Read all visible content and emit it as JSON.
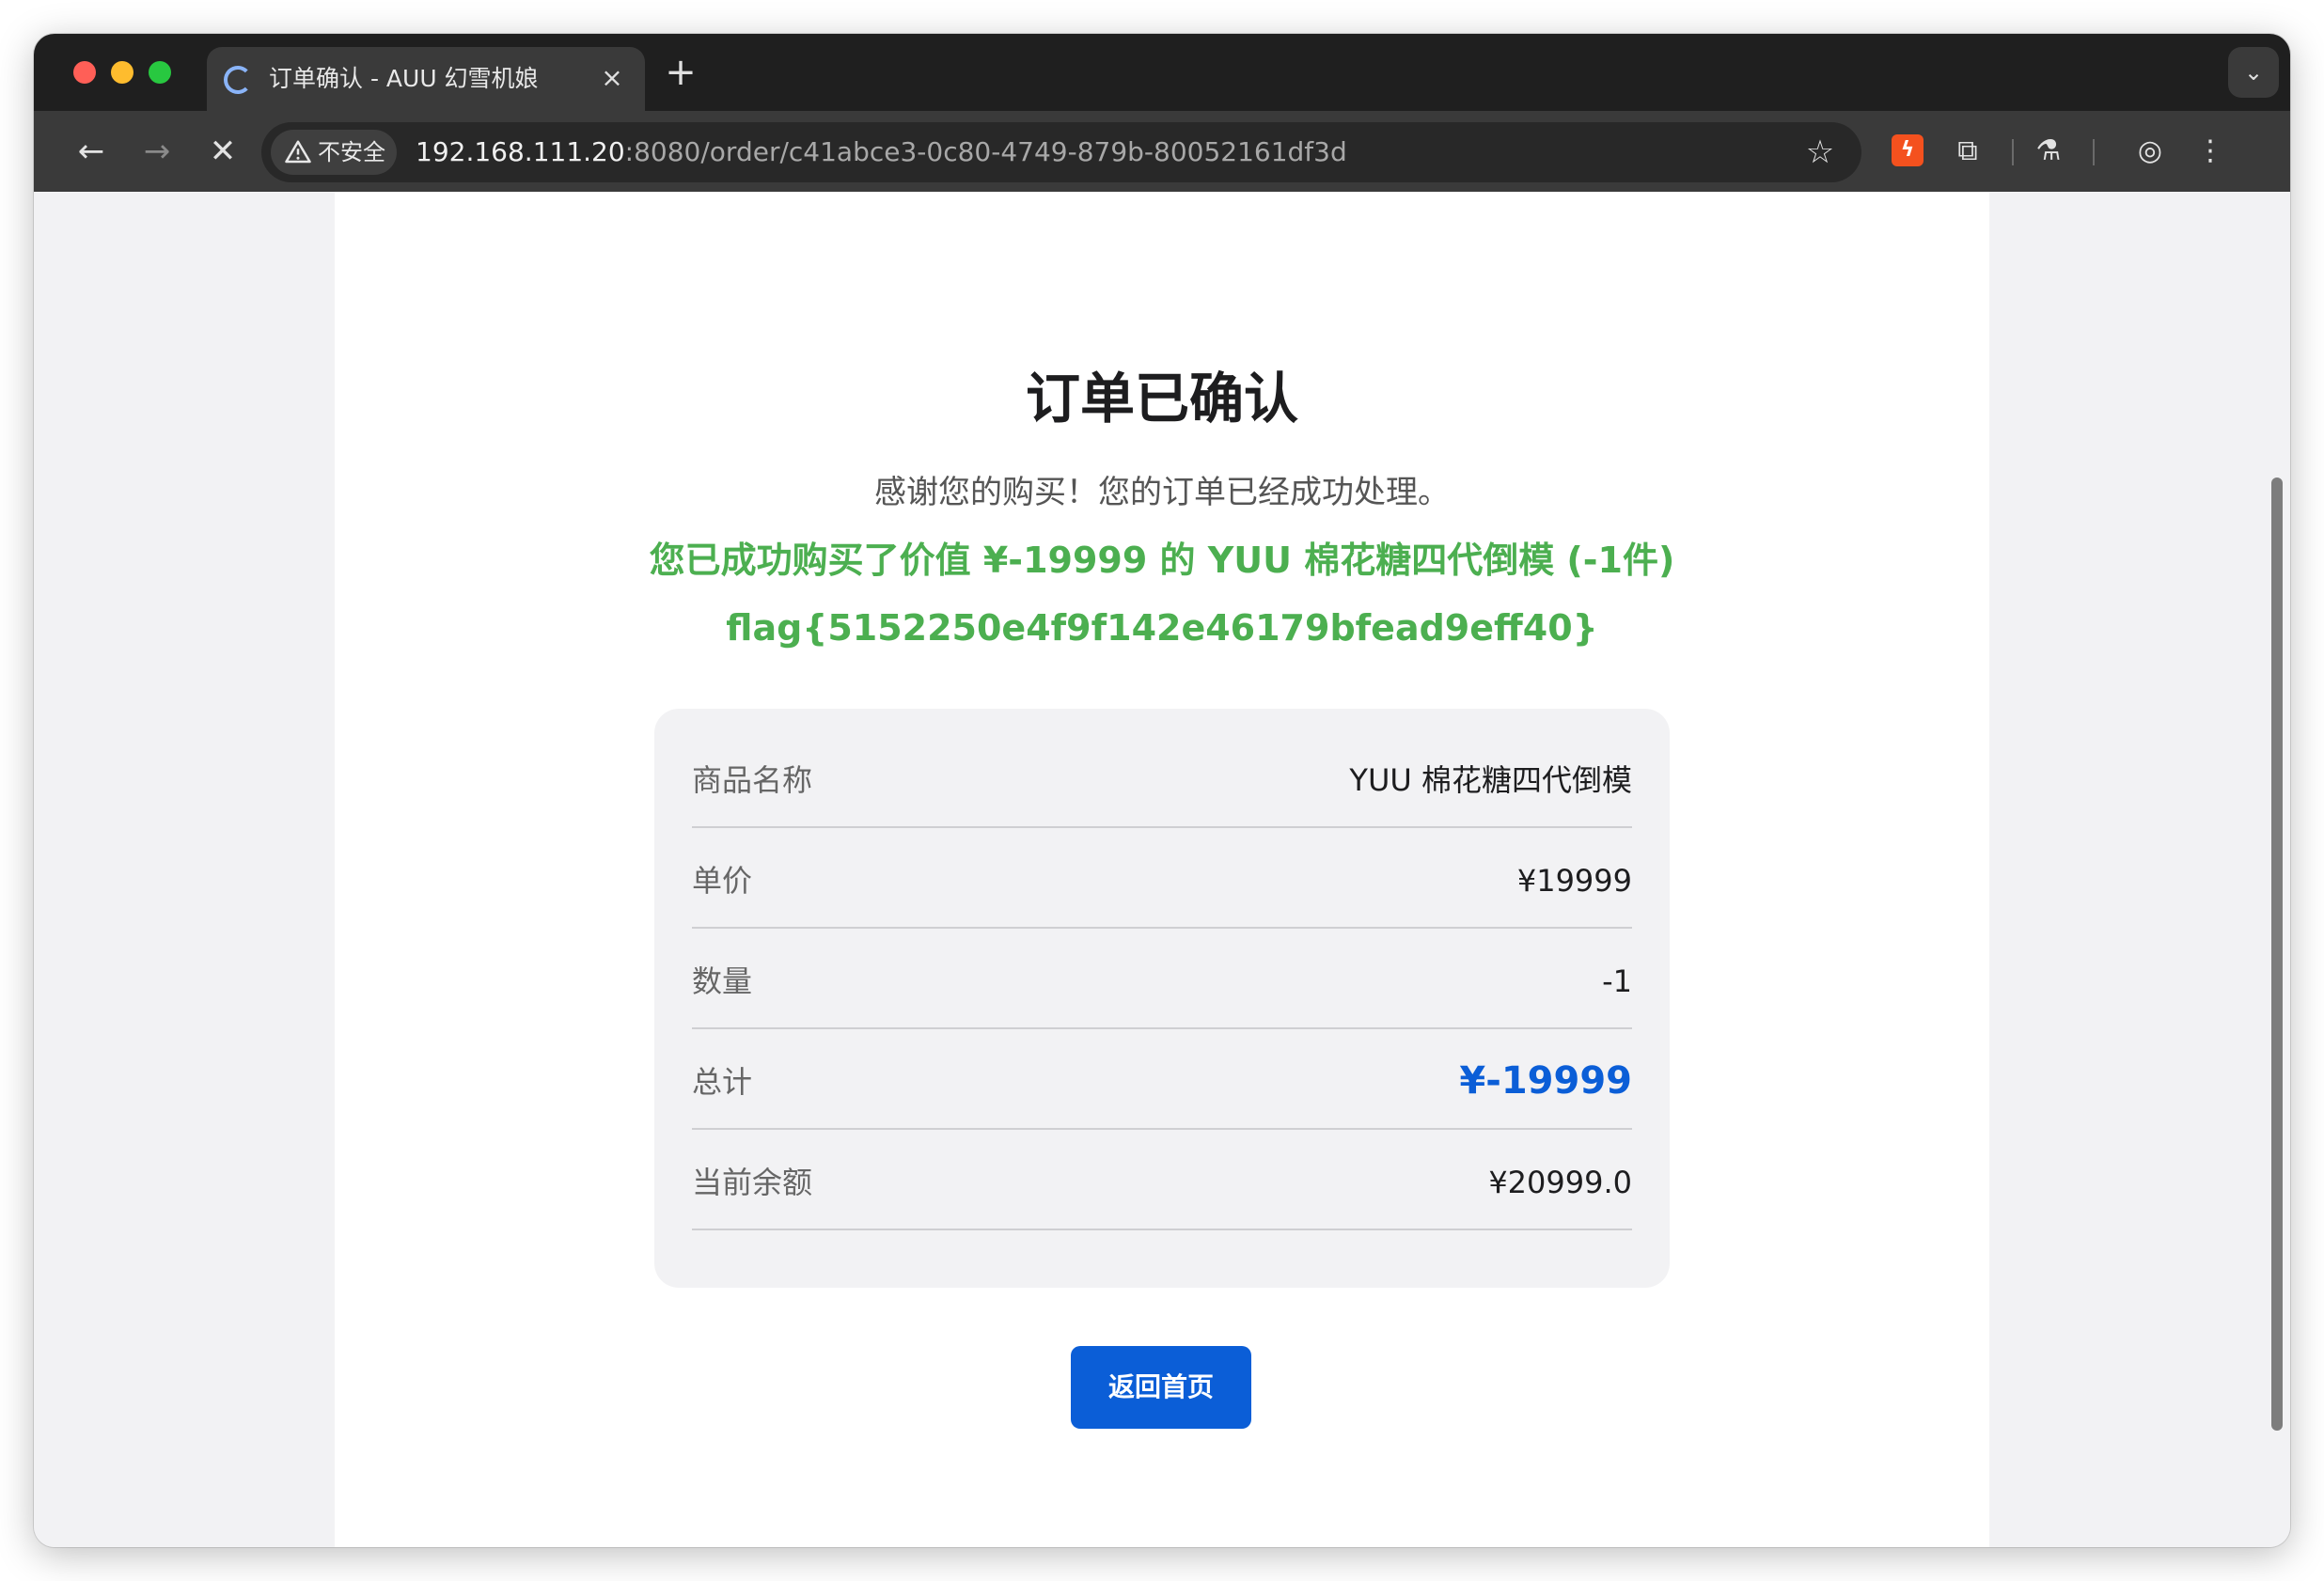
{
  "browser": {
    "tab_title": "订单确认 - AUU 幻雪机娘",
    "tab_close": "×",
    "new_tab": "+",
    "tab_search": "⌄",
    "security_label": "不安全",
    "url_host": "192.168.111.20",
    "url_path": ":8080/order/c41abce3-0c80-4749-879b-80052161df3d",
    "icons": [
      "back-icon",
      "forward-icon",
      "stop-icon",
      "warning-icon",
      "star-icon",
      "extension-icon",
      "puzzle-icon",
      "lab-icon",
      "profile-icon",
      "menu-icon"
    ]
  },
  "page": {
    "title": "订单已确认",
    "subtitle": "感谢您的购买！您的订单已经成功处理。",
    "success_line1": "您已成功购买了价值 ¥-19999 的 YUU 棉花糖四代倒模 (-1件)",
    "success_line2": "flag{5152250e4f9f142e46179bfead9eff40}",
    "details": [
      {
        "label": "商品名称",
        "value": "YUU 棉花糖四代倒模"
      },
      {
        "label": "单价",
        "value": "¥19999"
      },
      {
        "label": "数量",
        "value": "-1"
      },
      {
        "label": "总计",
        "value": "¥-19999"
      },
      {
        "label": "当前余额",
        "value": "¥20999.0"
      }
    ],
    "home_button": "返回首页"
  },
  "colors": {
    "success": "#4caf50",
    "accent": "#0b5ed7"
  }
}
